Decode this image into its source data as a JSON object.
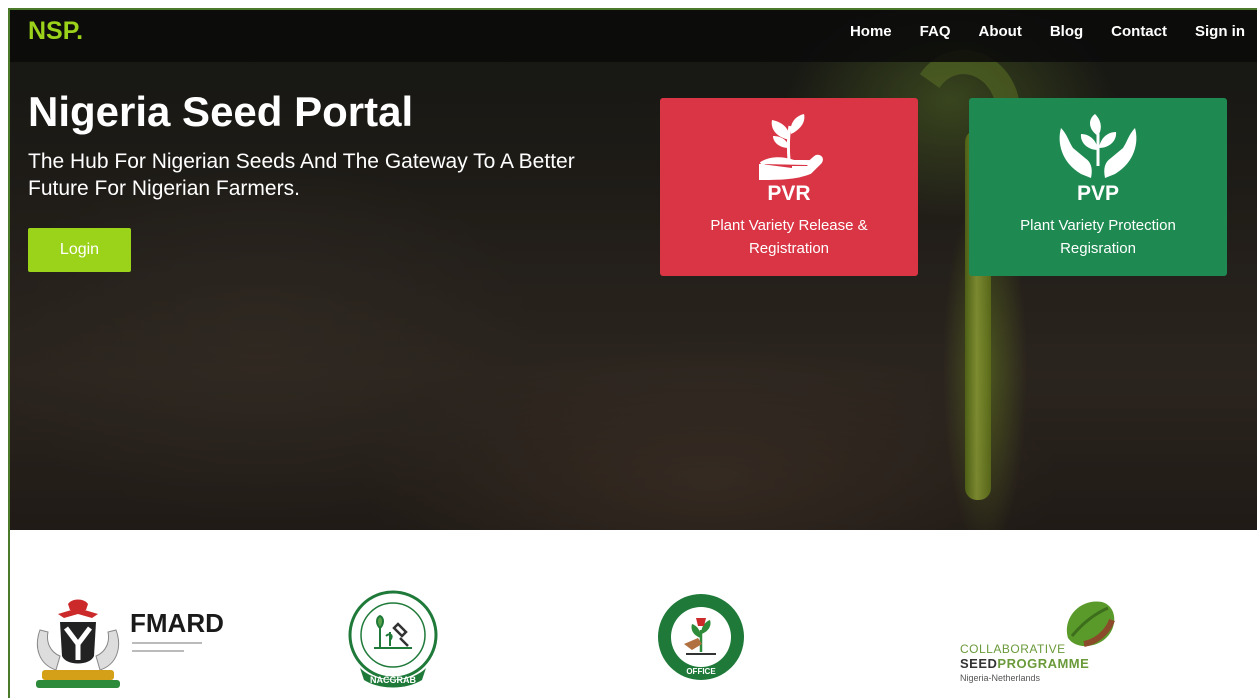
{
  "brand": "NSP.",
  "nav": {
    "items": [
      "Home",
      "FAQ",
      "About",
      "Blog",
      "Contact",
      "Sign in"
    ]
  },
  "hero": {
    "title": "Nigeria Seed Portal",
    "subtitle": "The Hub For Nigerian Seeds And The Gateway To A Better Future For Nigerian Farmers.",
    "login_label": "Login"
  },
  "cards": [
    {
      "code": "PVR",
      "description": "Plant Variety Release & Registration",
      "color": "#d93545",
      "icon": "seedling-hand-icon"
    },
    {
      "code": "PVP",
      "description": "Plant Variety Protection Regisration",
      "color": "#1e8a52",
      "icon": "cupped-hands-plant-icon"
    }
  ],
  "logos": {
    "fmard": {
      "text": "FMARD",
      "icon": "coat-of-arms-icon"
    },
    "nacgrab": {
      "text": "NACGRAB",
      "icon": "nacgrab-seal-icon"
    },
    "pvp_office": {
      "text": "OFFICE",
      "icon": "pvp-office-seal-icon"
    },
    "csp": {
      "line1": "COLLABORATIVE",
      "line2_a": "SEED",
      "line2_b": "PROGRAMME",
      "line3": "Nigeria-Netherlands",
      "icon": "seed-leaf-icon"
    }
  },
  "colors": {
    "accent": "#9bd21a",
    "pvr": "#d93545",
    "pvp": "#1e8a52"
  }
}
